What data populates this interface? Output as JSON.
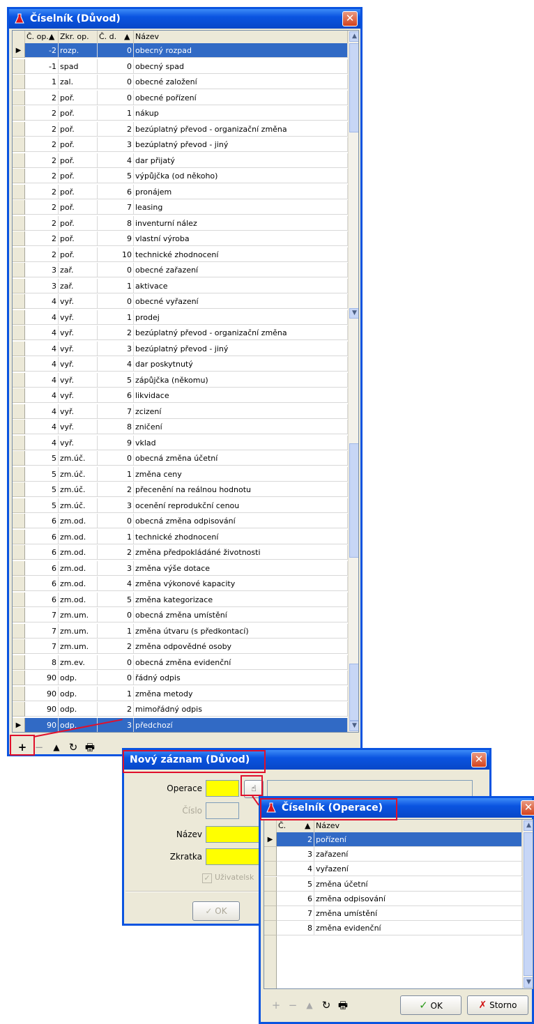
{
  "win1": {
    "title": "Číselník (Důvod)",
    "headers": [
      "Č. op.▲",
      "Zkr. op.",
      "Č. d.",
      "▲",
      "Název"
    ],
    "rows": [
      [
        "-2",
        "rozp.",
        "0",
        "obecný rozpad"
      ],
      [
        "-1",
        "spad",
        "0",
        "obecný spad"
      ],
      [
        "1",
        "zal.",
        "0",
        "obecné založení"
      ],
      [
        "2",
        "poř.",
        "0",
        "obecné pořízení"
      ],
      [
        "2",
        "poř.",
        "1",
        "nákup"
      ],
      [
        "2",
        "poř.",
        "2",
        "bezúplatný převod - organizační změna"
      ],
      [
        "2",
        "poř.",
        "3",
        "bezúplatný převod - jiný"
      ],
      [
        "2",
        "poř.",
        "4",
        "dar přijatý"
      ],
      [
        "2",
        "poř.",
        "5",
        "výpůjčka (od někoho)"
      ],
      [
        "2",
        "poř.",
        "6",
        "pronájem"
      ],
      [
        "2",
        "poř.",
        "7",
        "leasing"
      ],
      [
        "2",
        "poř.",
        "8",
        "inventurní nález"
      ],
      [
        "2",
        "poř.",
        "9",
        "vlastní výroba"
      ],
      [
        "2",
        "poř.",
        "10",
        "technické zhodnocení"
      ],
      [
        "3",
        "zař.",
        "0",
        "obecné zařazení"
      ],
      [
        "3",
        "zař.",
        "1",
        "aktivace"
      ],
      [
        "4",
        "vyř.",
        "0",
        "obecné vyřazení"
      ],
      [
        "4",
        "vyř.",
        "1",
        "prodej"
      ],
      [
        "4",
        "vyř.",
        "2",
        "bezúplatný převod - organizační změna"
      ],
      [
        "4",
        "vyř.",
        "3",
        "bezúplatný převod - jiný"
      ],
      [
        "4",
        "vyř.",
        "4",
        "dar poskytnutý"
      ],
      [
        "4",
        "vyř.",
        "5",
        "zápůjčka (někomu)"
      ],
      [
        "4",
        "vyř.",
        "6",
        "likvidace"
      ],
      [
        "4",
        "vyř.",
        "7",
        "zcizení"
      ],
      [
        "4",
        "vyř.",
        "8",
        "zničení"
      ],
      [
        "4",
        "vyř.",
        "9",
        "vklad"
      ],
      [
        "5",
        "zm.úč.",
        "0",
        "obecná změna účetní"
      ],
      [
        "5",
        "zm.úč.",
        "1",
        "změna ceny"
      ],
      [
        "5",
        "zm.úč.",
        "2",
        "přecenění na reálnou hodnotu"
      ],
      [
        "5",
        "zm.úč.",
        "3",
        "ocenění reprodukční cenou"
      ],
      [
        "6",
        "zm.od.",
        "0",
        "obecná změna odpisování"
      ],
      [
        "6",
        "zm.od.",
        "1",
        "technické zhodnocení"
      ],
      [
        "6",
        "zm.od.",
        "2",
        "změna předpokládáné životnosti"
      ],
      [
        "6",
        "zm.od.",
        "3",
        "změna výše dotace"
      ],
      [
        "6",
        "zm.od.",
        "4",
        "změna výkonové kapacity"
      ],
      [
        "6",
        "zm.od.",
        "5",
        "změna kategorizace"
      ],
      [
        "7",
        "zm.um.",
        "0",
        "obecná změna umístění"
      ],
      [
        "7",
        "zm.um.",
        "1",
        "změna útvaru (s předkontací)"
      ],
      [
        "7",
        "zm.um.",
        "2",
        "změna odpovědné osoby"
      ],
      [
        "8",
        "zm.ev.",
        "0",
        "obecná změna evidenční"
      ],
      [
        "90",
        "odp.",
        "0",
        "řádný odpis"
      ],
      [
        "90",
        "odp.",
        "1",
        "změna metody"
      ],
      [
        "90",
        "odp.",
        "2",
        "mimořádný odpis"
      ],
      [
        "90",
        "odp.",
        "3",
        "předchozí"
      ]
    ],
    "selected_rows": [
      0,
      43
    ],
    "toolbar": [
      "+",
      "−",
      "▲",
      "↻",
      "🖶"
    ]
  },
  "win2": {
    "title": "Nový záznam (Důvod)",
    "labels": {
      "operace": "Operace",
      "cislo": "Číslo",
      "nazev": "Název",
      "zkratka": "Zkratka"
    },
    "checkbox_label": "Uživatelsk",
    "ok_label": "OK"
  },
  "win3": {
    "title": "Číselník (Operace)",
    "headers": [
      "Č.",
      "▲",
      "Název"
    ],
    "rows": [
      [
        "2",
        "pořízení"
      ],
      [
        "3",
        "zařazení"
      ],
      [
        "4",
        "vyřazení"
      ],
      [
        "5",
        "změna účetní"
      ],
      [
        "6",
        "změna odpisování"
      ],
      [
        "7",
        "změna umístění"
      ],
      [
        "8",
        "změna evidenční"
      ]
    ],
    "selected_rows": [
      0
    ],
    "ok_label": "OK",
    "storno_label": "Storno"
  },
  "colors": {
    "highlight": "#316ac5",
    "annotation": "#e0102b",
    "required_field": "#ffff00"
  }
}
